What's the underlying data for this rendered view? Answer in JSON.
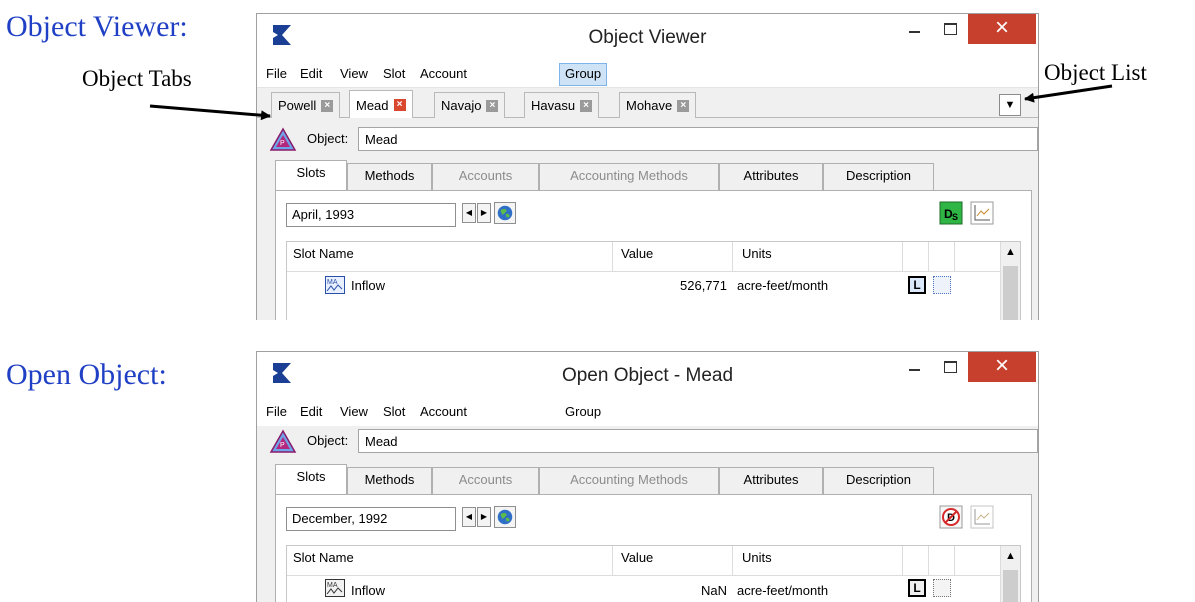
{
  "callouts": {
    "object_viewer": "Object Viewer:",
    "object_tabs": "Object Tabs",
    "object_list": "Object List",
    "open_object": "Open Object:"
  },
  "colors": {
    "callout_blue": "#1f3fc4",
    "close_red": "#c7402e",
    "menu_highlight": "#cfe3f7"
  },
  "viewer": {
    "title": "Object Viewer",
    "menus": [
      "File",
      "Edit",
      "View",
      "Slot",
      "Account",
      "Group"
    ],
    "object_tabs": [
      "Powell",
      "Mead",
      "Navajo",
      "Havasu",
      "Mohave"
    ],
    "object_list_icon": "▼",
    "object_label": "Object:",
    "object_value": "Mead",
    "panel_tabs": [
      "Slots",
      "Methods",
      "Accounts",
      "Accounting Methods",
      "Attributes",
      "Description"
    ],
    "date": "April, 1993",
    "columns": [
      "Slot Name",
      "Value",
      "Units"
    ],
    "row": {
      "name": "Inflow",
      "value": "526,771",
      "units": "acre-feet/month",
      "flag": "L"
    }
  },
  "open_object": {
    "title": "Open Object - Mead",
    "menus": [
      "File",
      "Edit",
      "View",
      "Slot",
      "Account",
      "Group"
    ],
    "object_label": "Object:",
    "object_value": "Mead",
    "panel_tabs": [
      "Slots",
      "Methods",
      "Accounts",
      "Accounting Methods",
      "Attributes",
      "Description"
    ],
    "date": "December, 1992",
    "columns": [
      "Slot Name",
      "Value",
      "Units"
    ],
    "row": {
      "name": "Inflow",
      "value": "NaN",
      "units": "acre-feet/month",
      "flag": "L"
    }
  }
}
